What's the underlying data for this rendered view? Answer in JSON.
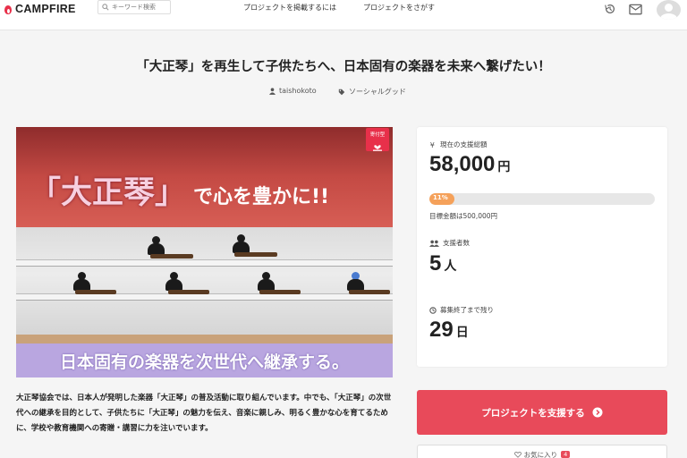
{
  "header": {
    "brand": "CAMPFIRE",
    "search_placeholder": "キーワード検索",
    "nav": [
      "プロジェクトを掲載するには",
      "プロジェクトをさがす"
    ],
    "icons": [
      "history-icon",
      "mail-icon",
      "avatar"
    ]
  },
  "project": {
    "title": "「大正琴」を再生して子供たちへ、日本固有の楽器を未来へ繋げたい！",
    "author": "taishokoto",
    "category": "ソーシャルグッド"
  },
  "hero": {
    "headline_big": "「大正琴」",
    "headline_small": "で心を豊かに!!",
    "banner": "日本固有の楽器を次世代へ継承する。",
    "badge": "寄付型"
  },
  "description": "大正琴協会では、日本人が発明した楽器「大正琴」の普及活動に取り組んでいます。中でも、「大正琴」の次世代への継承を目的として、子供たちに「大正琴」の魅力を伝え、音楽に親しみ、明るく豊かな心を育てるために、学校や教育機関への寄贈・講習に力を注いでいます。",
  "stats": {
    "raised_label": "現在の支援総額",
    "raised_value": "58,000",
    "raised_unit": "円",
    "progress_percent": 11,
    "progress_text": "11%",
    "goal_text": "目標金額は500,000円",
    "supporters_label": "支援者数",
    "supporters_value": "5",
    "supporters_unit": "人",
    "remaining_label": "募集終了まで残り",
    "remaining_value": "29",
    "remaining_unit": "日"
  },
  "cta": {
    "support_label": "プロジェクトを支援する",
    "favorite_label": "お気に入り",
    "favorite_count": "4"
  },
  "colors": {
    "brand": "#e8304a",
    "cta": "#e84a5a",
    "progress": "#f5a15a"
  }
}
